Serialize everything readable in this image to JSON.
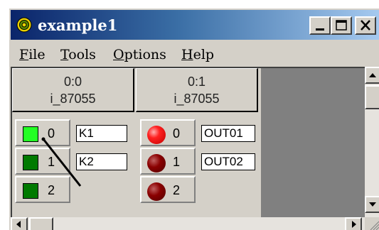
{
  "window": {
    "title": "example1",
    "app_icon": "target-icon",
    "controls": [
      "minimize-icon",
      "maximize-icon",
      "close-icon"
    ]
  },
  "menubar": {
    "items": [
      {
        "mnemonic": "F",
        "rest": "ile"
      },
      {
        "mnemonic": "T",
        "rest": "ools"
      },
      {
        "mnemonic": "O",
        "rest": "ptions"
      },
      {
        "mnemonic": "H",
        "rest": "elp"
      }
    ]
  },
  "modules": [
    {
      "address": "0:0",
      "name": "i_87055",
      "channels": [
        {
          "index": "0",
          "state": "on",
          "label": "K1"
        },
        {
          "index": "1",
          "state": "off",
          "label": "K2"
        },
        {
          "index": "2",
          "state": "off",
          "label": ""
        }
      ]
    },
    {
      "address": "0:1",
      "name": "i_87055",
      "channels": [
        {
          "index": "0",
          "state": "on",
          "label": "OUT01"
        },
        {
          "index": "1",
          "state": "off",
          "label": "OUT02"
        },
        {
          "index": "2",
          "state": "off",
          "label": ""
        }
      ]
    }
  ],
  "colors": {
    "input_on": "#24ff24",
    "input_off": "#007a00",
    "output_on": "#ff2020",
    "output_off": "#8a0000",
    "title_start": "#0a246a",
    "title_end": "#a6caf0"
  }
}
